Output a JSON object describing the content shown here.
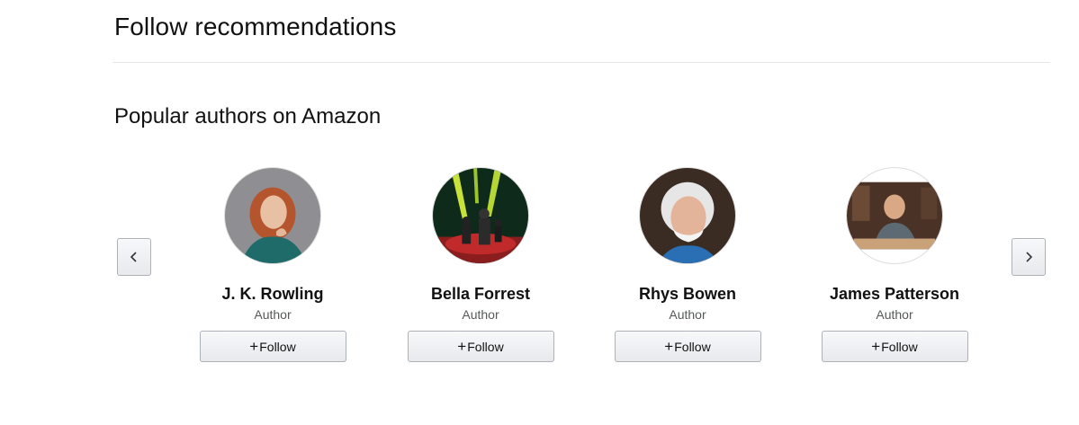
{
  "page": {
    "title": "Follow recommendations",
    "subtitle": "Popular authors on Amazon"
  },
  "carousel": {
    "prev_icon": "chevron-left-icon",
    "next_icon": "chevron-right-icon"
  },
  "authors": [
    {
      "name": "J. K. Rowling",
      "role": "Author",
      "follow_label": "Follow",
      "follow_icon": "+"
    },
    {
      "name": "Bella Forrest",
      "role": "Author",
      "follow_label": "Follow",
      "follow_icon": "+"
    },
    {
      "name": "Rhys Bowen",
      "role": "Author",
      "follow_label": "Follow",
      "follow_icon": "+"
    },
    {
      "name": "James Patterson",
      "role": "Author",
      "follow_label": "Follow",
      "follow_icon": "+"
    }
  ],
  "colors": {
    "divider": "#e7e7e7",
    "button_border": "#adb1b8",
    "secondary_text": "#565959"
  }
}
